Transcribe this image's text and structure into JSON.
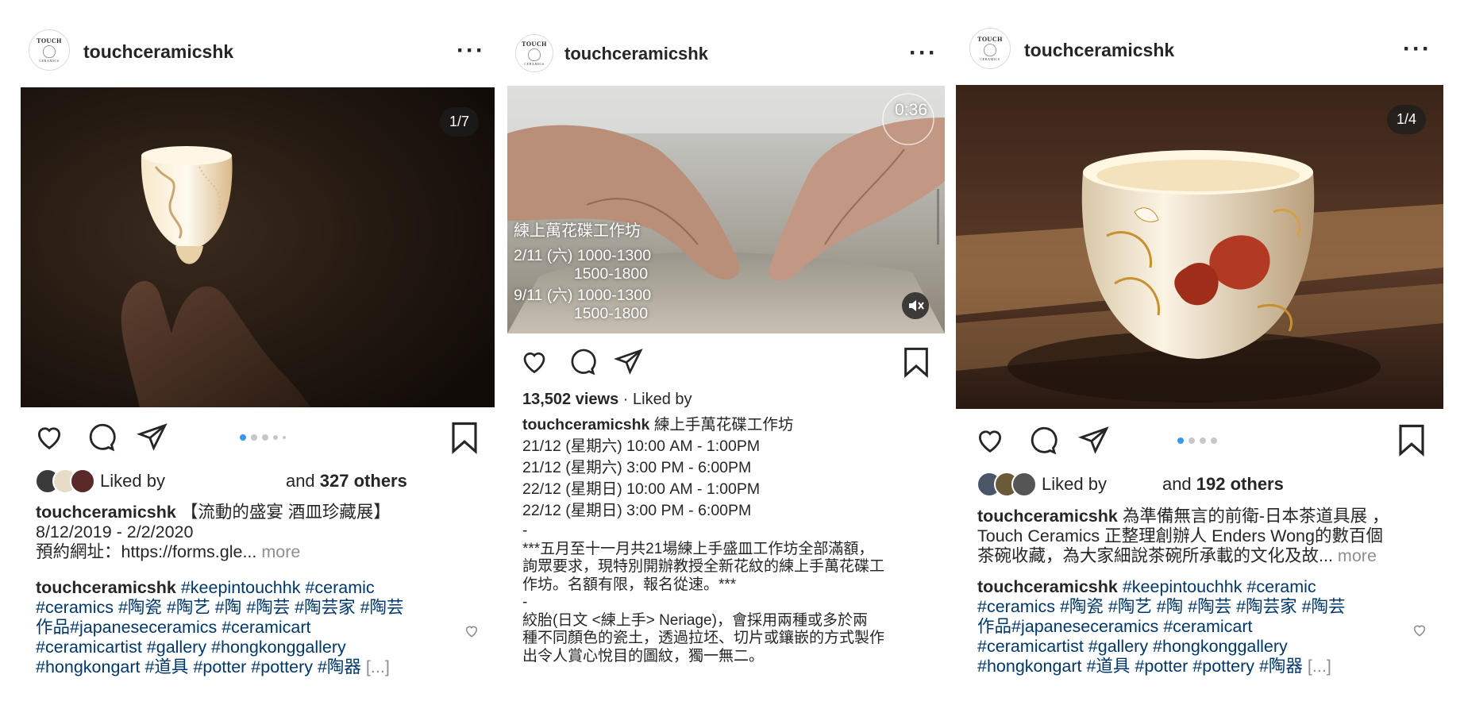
{
  "posts": [
    {
      "username": "touchceramicshk",
      "avatar_text": [
        "TOUCH",
        "CERAMICS"
      ],
      "media_counter": "1/7",
      "liked_by_prefix": "Liked by",
      "liked_by_suffix": "and",
      "liked_count": "327 others",
      "caption_user": "touchceramicshk",
      "caption_lines": [
        "【流動的盛宴 酒皿珍藏展】",
        "8/12/2019 - 2/2/2020",
        "預約網址：https://forms.gle..."
      ],
      "more_label": "more",
      "comment_user": "touchceramicshk",
      "comment_lines": [
        "#keepintouchhk #ceramic",
        "#ceramics  #陶瓷 #陶艺 #陶 #陶芸 #陶芸家 #陶芸",
        "作品#japaneseceramics #ceramicart",
        "#ceramicartist #gallery #hongkonggallery",
        "#hongkongart #道具 #potter #pottery #陶器"
      ],
      "truncation": "[...]"
    },
    {
      "username": "touchceramicshk",
      "avatar_text": [
        "TOUCH",
        "CERAMICS"
      ],
      "video_time": "0:36",
      "video_overlay": {
        "title": "練上萬花碟工作坊",
        "lines": [
          "2/11 (六) 1000-1300",
          "              1500-1800",
          "9/11 (六) 1000-1300",
          "              1500-1800"
        ]
      },
      "views": "13,502 views",
      "liked_by": "Liked by",
      "caption_user": "touchceramicshk",
      "caption_title": "練上手萬花碟工作坊",
      "caption_lines": [
        "21/12 (星期六) 10:00 AM - 1:00PM",
        "21/12 (星期六) 3:00 PM - 6:00PM",
        "22/12 (星期日) 10:00 AM - 1:00PM",
        "22/12 (星期日) 3:00 PM - 6:00PM",
        "-",
        "***五月至十一月共21場練上手盛皿工作坊全部滿額，",
        "詢眾要求，現特別開辦教授全新花紋的練上手萬花碟工",
        "作坊。名額有限，報名從速。***",
        "-",
        "絞胎(日文 <練上手> Neriage)，會採用兩種或多於兩",
        "種不同顏色的瓷土，透過拉坯、切片或鑲嵌的方式製作",
        "出令人賞心悅目的圖紋，獨一無二。"
      ]
    },
    {
      "username": "touchceramicshk",
      "avatar_text": [
        "TOUCH",
        "CERAMICS"
      ],
      "media_counter": "1/4",
      "liked_by_prefix": "Liked by",
      "liked_by_suffix": "and",
      "liked_count": "192 others",
      "caption_user": "touchceramicshk",
      "caption_lines": [
        "為準備無言的前衛-日本茶道具展 ，",
        "Touch Ceramics 正整理創辦人 Enders Wong的數百個",
        "茶碗收藏，為大家細說茶碗所承載的文化及故..."
      ],
      "more_label": "more",
      "comment_user": "touchceramicshk",
      "comment_lines": [
        "#keepintouchhk #ceramic",
        "#ceramics  #陶瓷 #陶艺 #陶 #陶芸 #陶芸家 #陶芸",
        "作品#japaneseceramics #ceramicart",
        "#ceramicartist #gallery #hongkonggallery",
        "#hongkongart #道具 #potter #pottery #陶器"
      ],
      "truncation": "[...]"
    }
  ],
  "colors": {
    "hashtag": "#00376b",
    "muted": "#8e8e8e",
    "active_dot": "#3897f0",
    "text": "#262626"
  },
  "icons": [
    "heart-icon",
    "comment-icon",
    "share-icon",
    "bookmark-icon",
    "more-icon",
    "mute-icon"
  ],
  "carousel": [
    {
      "dot_count": 5,
      "active_dot": 1
    },
    {
      "dot_count": 4,
      "active_dot": 1
    }
  ]
}
